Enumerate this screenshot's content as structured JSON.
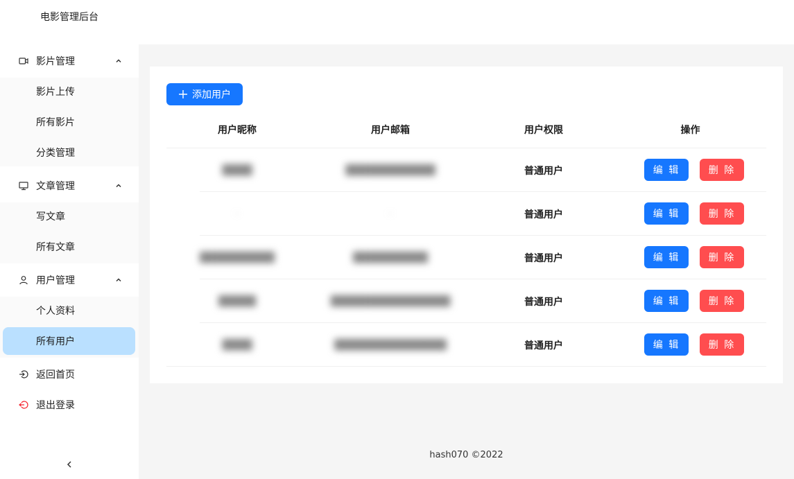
{
  "header": {
    "brand": "电影管理后台"
  },
  "sidebar": {
    "groups": [
      {
        "label": "影片管理",
        "icon": "video-camera-icon",
        "items": [
          "影片上传",
          "所有影片",
          "分类管理"
        ]
      },
      {
        "label": "文章管理",
        "icon": "desktop-icon",
        "items": [
          "写文章",
          "所有文章"
        ]
      },
      {
        "label": "用户管理",
        "icon": "user-icon",
        "items": [
          "个人资料",
          "所有用户"
        ]
      }
    ],
    "active_item": "所有用户",
    "back_home": "返回首页",
    "logout": "退出登录",
    "collapse_icon": "chevron-left-icon"
  },
  "toolbar": {
    "add_user": "添加用户"
  },
  "table": {
    "columns": [
      "用户昵称",
      "用户邮箱",
      "用户权限",
      "操作"
    ],
    "rows": [
      {
        "nickname": "████",
        "email": "████████████",
        "permission": "普通用户"
      },
      {
        "nickname": "·",
        "email": "·",
        "permission": "普通用户"
      },
      {
        "nickname": "██████████",
        "email": "██████████",
        "permission": "普通用户"
      },
      {
        "nickname": "█████",
        "email": "████████████████",
        "permission": "普通用户"
      },
      {
        "nickname": "████",
        "email": "███████████████",
        "permission": "普通用户"
      }
    ],
    "edit_label": "编 辑",
    "delete_label": "删 除"
  },
  "footer": {
    "text": "hash070 ©2022"
  },
  "colors": {
    "primary": "#1677ff",
    "danger": "#ff4d4f",
    "active_bg": "#bae0ff",
    "logout_icon": "#f5222d"
  }
}
